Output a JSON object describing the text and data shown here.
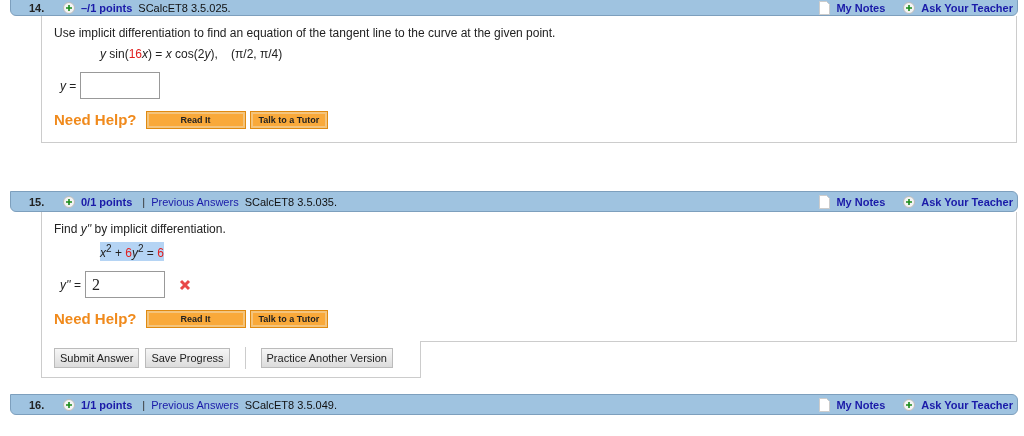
{
  "questions": [
    {
      "number": "14.",
      "points": "–/1 points",
      "source": "SCalcET8 3.5.025.",
      "my_notes": "My Notes",
      "ask": "Ask Your Teacher",
      "prompt": "Use implicit differentiation to find an equation of the tangent line to the curve at the given point.",
      "equation": {
        "highlighted": false,
        "parts": [
          {
            "text": "*y* sin(",
            "red": false
          },
          {
            "text": "16",
            "red": true
          },
          {
            "text": "*x*) = *x* cos(2",
            "red": false
          },
          {
            "text": "*y*",
            "red": false
          },
          {
            "text": "),    (π/2, π/4)",
            "red": false
          }
        ]
      },
      "answer": {
        "label": "*y* =",
        "incorrect": false
      },
      "help": {
        "label": "Need Help?",
        "buttons": [
          "Read It",
          "Talk to a Tutor"
        ]
      }
    },
    {
      "number": "15.",
      "points": "0/1 points",
      "separator": "|",
      "previous_answers": "Previous Answers",
      "source": "SCalcET8 3.5.035.",
      "my_notes": "My Notes",
      "ask": "Ask Your Teacher",
      "prompt": "Find *y''* by implicit differentiation.",
      "equation": {
        "highlighted": true,
        "parts": [
          {
            "text": "*x*$^{2}$ + ",
            "red": false
          },
          {
            "text": "6",
            "red": true
          },
          {
            "text": "*y*$^{2}$ = ",
            "red": false
          },
          {
            "text": "6",
            "red": true
          }
        ]
      },
      "answer": {
        "label": "*y''* =",
        "value": "2",
        "incorrect": true
      },
      "help": {
        "label": "Need Help?",
        "buttons": [
          "Read It",
          "Talk to a Tutor"
        ]
      },
      "actions": [
        "Submit Answer",
        "Save Progress",
        "Practice Another Version"
      ]
    },
    {
      "number": "16.",
      "points": "1/1 points",
      "separator": "|",
      "previous_answers": "Previous Answers",
      "source": "SCalcET8 3.5.049.",
      "my_notes": "My Notes",
      "ask": "Ask Your Teacher"
    }
  ]
}
